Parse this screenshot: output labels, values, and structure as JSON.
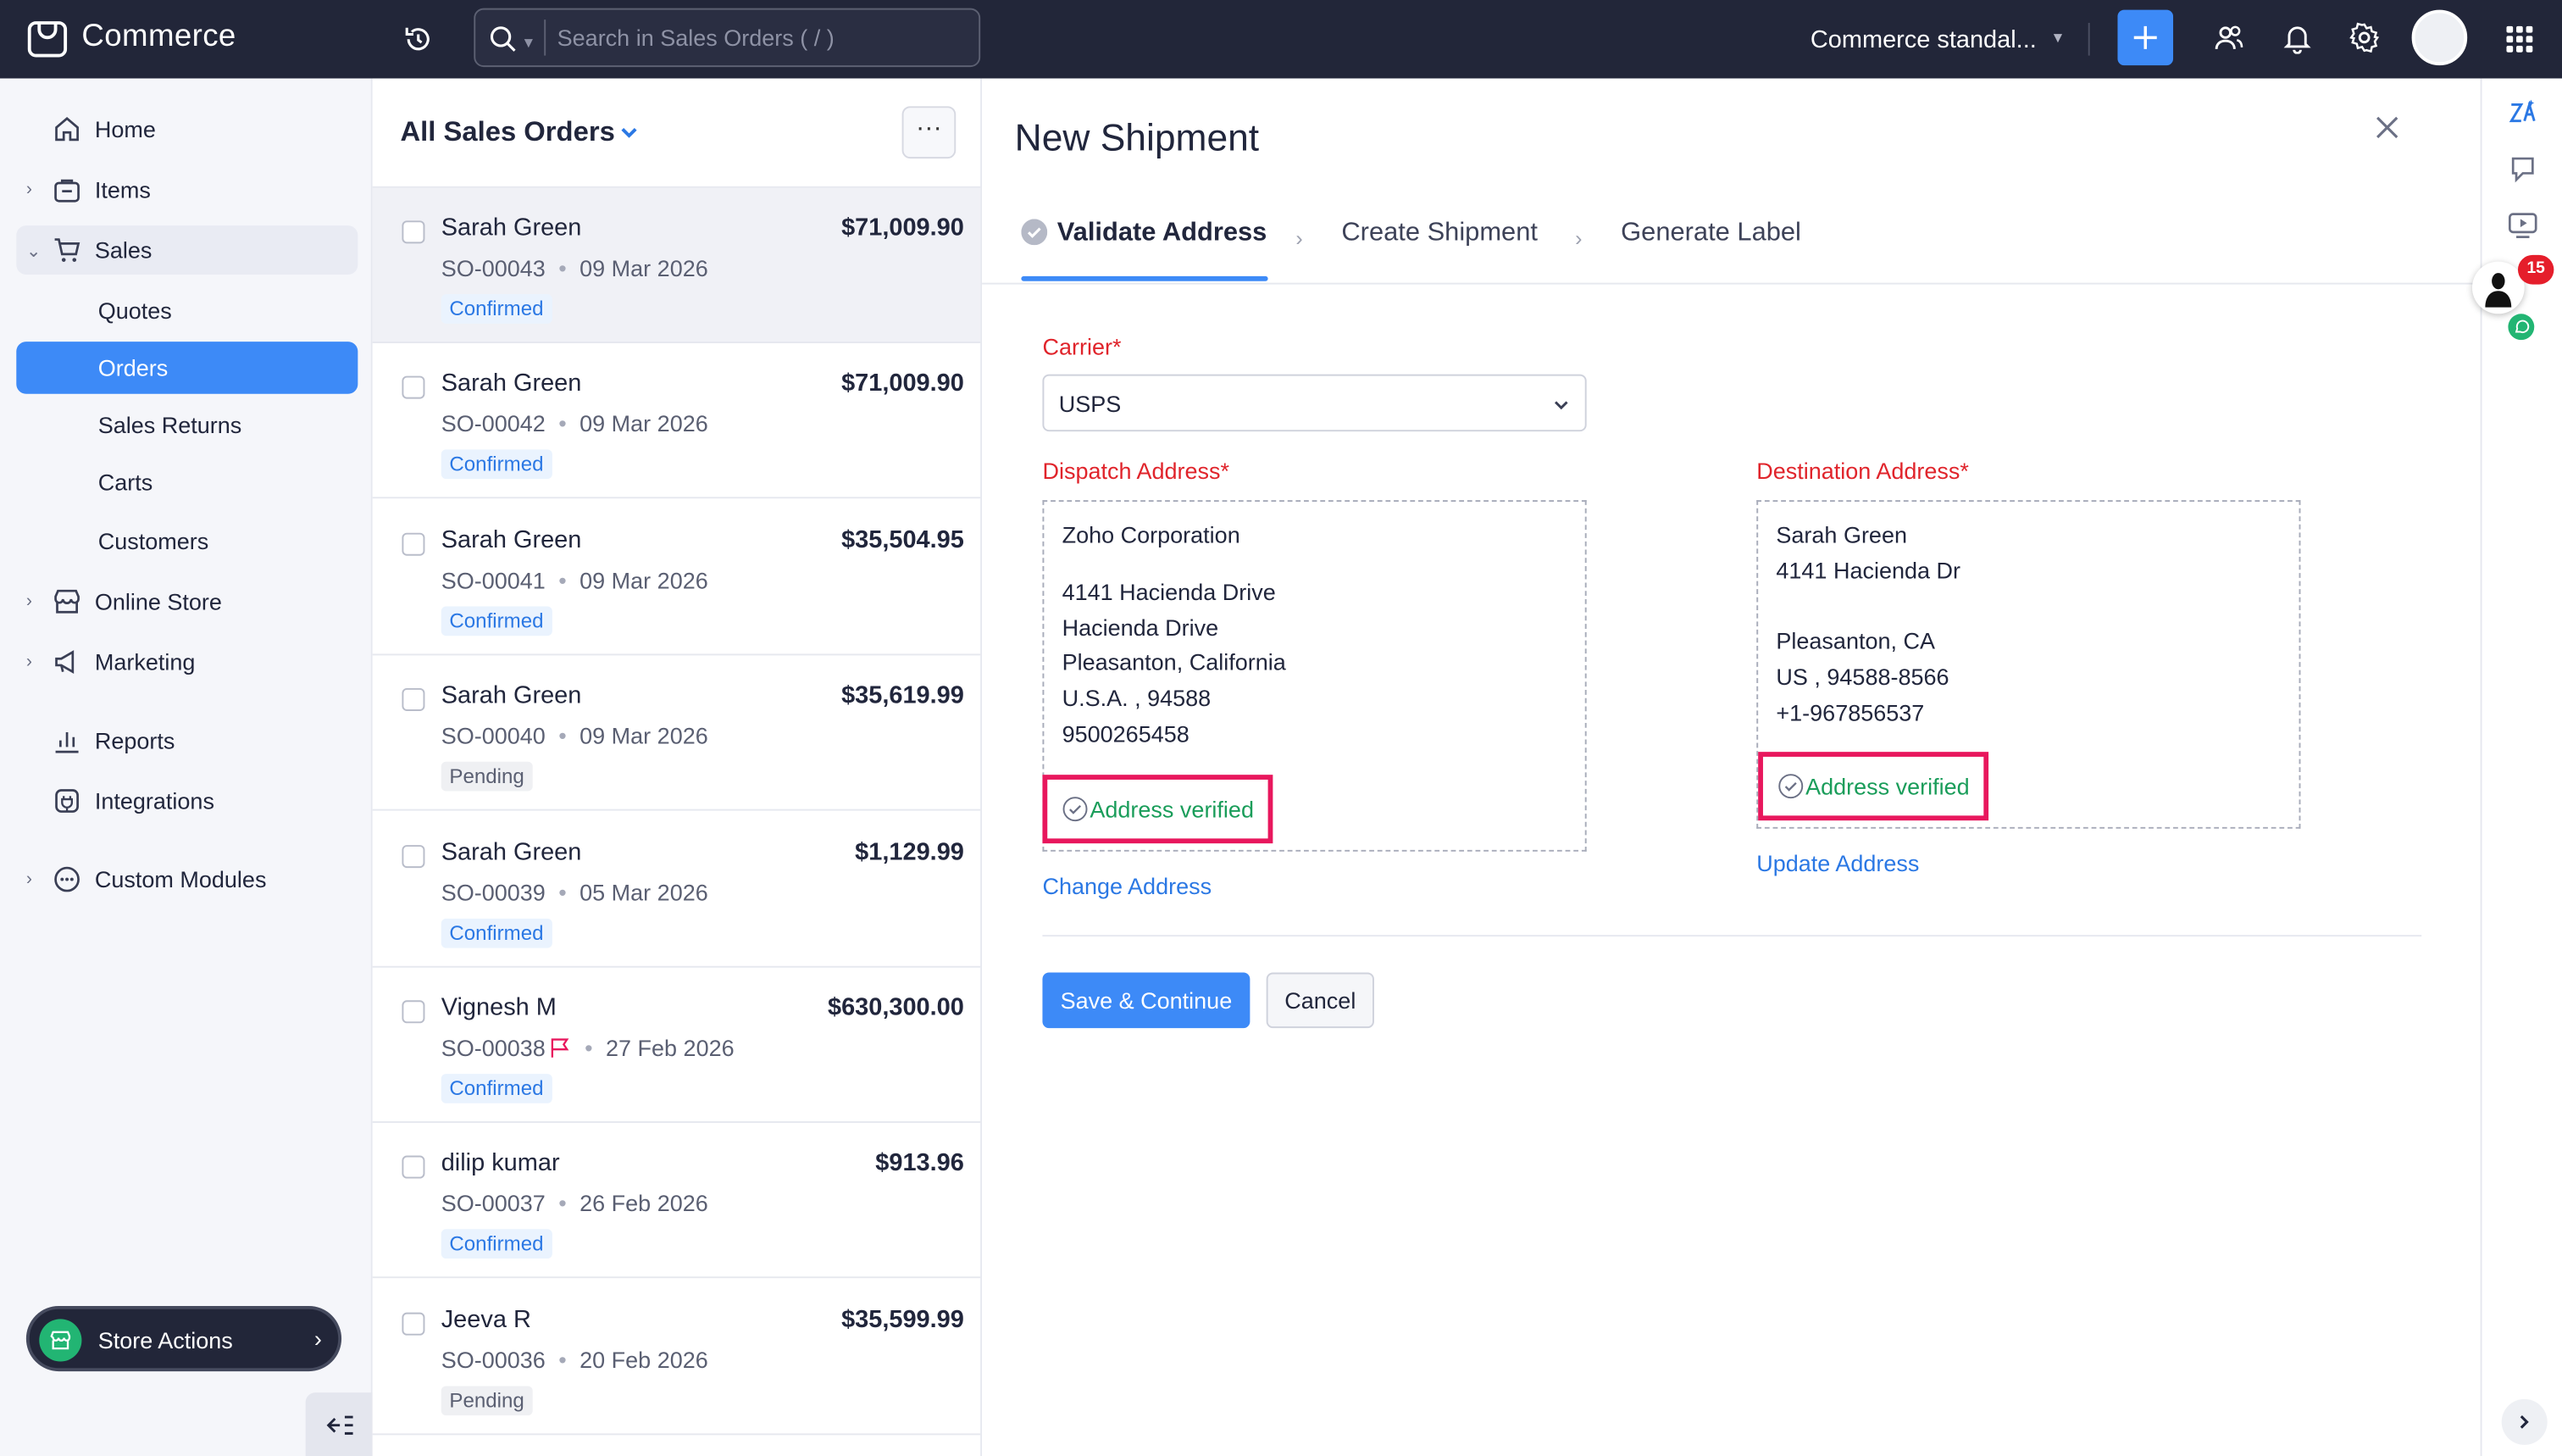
{
  "app": {
    "brand": "Commerce",
    "search_placeholder": "Search in Sales Orders ( / )",
    "org_name": "Commerce standal...",
    "accent_color": "#3d8af7",
    "topbar_color": "#222639"
  },
  "sidebar": {
    "home": "Home",
    "items": "Items",
    "sales": "Sales",
    "quotes": "Quotes",
    "orders": "Orders",
    "sales_returns": "Sales Returns",
    "carts": "Carts",
    "customers": "Customers",
    "online_store": "Online Store",
    "marketing": "Marketing",
    "reports": "Reports",
    "integrations": "Integrations",
    "custom_modules": "Custom Modules",
    "store_actions": "Store Actions"
  },
  "list": {
    "title": "All Sales Orders",
    "orders": [
      {
        "name": "Sarah Green",
        "amount": "$71,009.90",
        "number": "SO-00043",
        "date": "09 Mar 2026",
        "status": "Confirmed"
      },
      {
        "name": "Sarah Green",
        "amount": "$71,009.90",
        "number": "SO-00042",
        "date": "09 Mar 2026",
        "status": "Confirmed"
      },
      {
        "name": "Sarah Green",
        "amount": "$35,504.95",
        "number": "SO-00041",
        "date": "09 Mar 2026",
        "status": "Confirmed"
      },
      {
        "name": "Sarah Green",
        "amount": "$35,619.99",
        "number": "SO-00040",
        "date": "09 Mar 2026",
        "status": "Pending"
      },
      {
        "name": "Sarah Green",
        "amount": "$1,129.99",
        "number": "SO-00039",
        "date": "05 Mar 2026",
        "status": "Confirmed"
      },
      {
        "name": "Vignesh M",
        "amount": "$630,300.00",
        "number": "SO-00038",
        "date": "27 Feb 2026",
        "status": "Confirmed"
      },
      {
        "name": "dilip kumar",
        "amount": "$913.96",
        "number": "SO-00037",
        "date": "26 Feb 2026",
        "status": "Confirmed"
      },
      {
        "name": "Jeeva R",
        "amount": "$35,599.99",
        "number": "SO-00036",
        "date": "20 Feb 2026",
        "status": "Pending"
      }
    ]
  },
  "shipment": {
    "title": "New Shipment",
    "steps": [
      "Validate Address",
      "Create Shipment",
      "Generate Label"
    ],
    "carrier_label": "Carrier*",
    "carrier_value": "USPS",
    "dispatch_label": "Dispatch Address*",
    "dispatch_name": "Zoho Corporation",
    "dispatch_lines": "4141 Hacienda Drive\nHacienda Drive\nPleasanton, California\nU.S.A. , 94588\n9500265458",
    "destination_label": "Destination Address*",
    "destination_lines": "Sarah Green\n4141 Hacienda Dr\n\nPleasanton, CA\nUS , 94588-8566\n+1-967856537",
    "verified_text": "Address verified",
    "change_address": "Change Address",
    "update_address": "Update Address",
    "save_label": "Save & Continue",
    "cancel_label": "Cancel"
  },
  "rail": {
    "notification_count": "15"
  }
}
